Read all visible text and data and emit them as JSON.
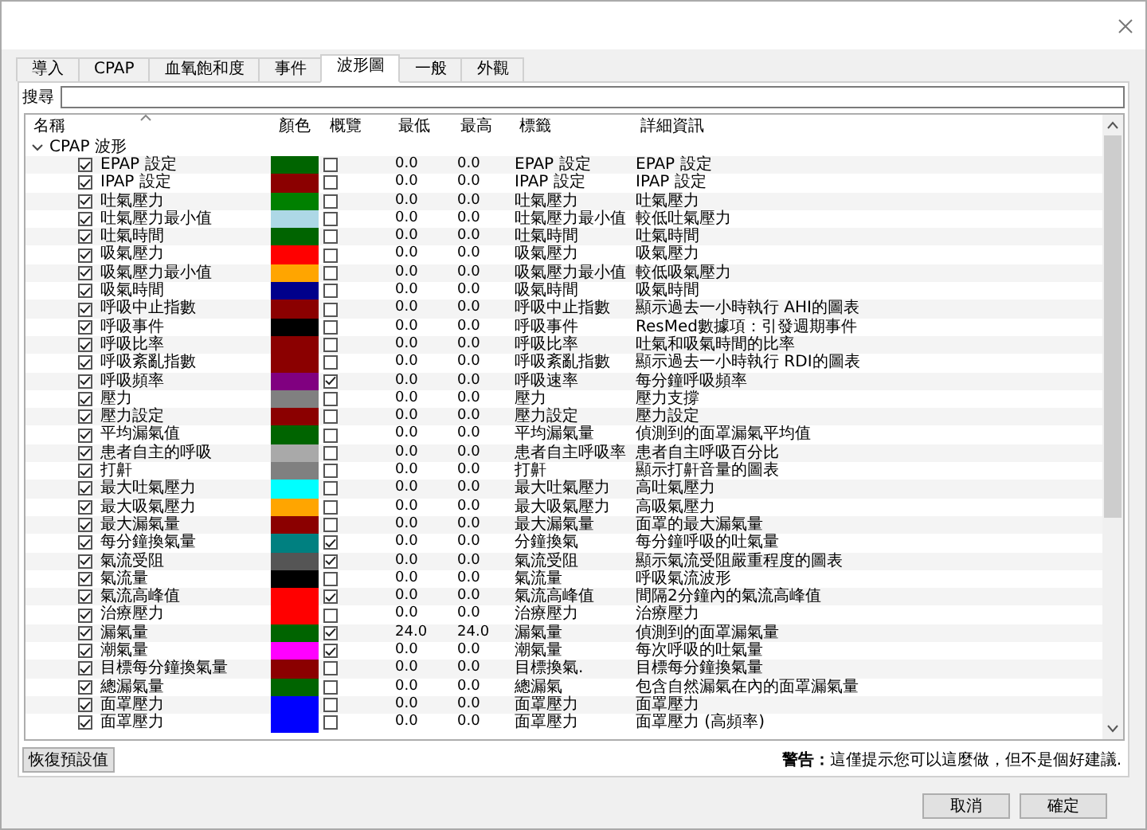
{
  "tabs": [
    {
      "label": "導入",
      "selected": false
    },
    {
      "label": "CPAP",
      "selected": false
    },
    {
      "label": "血氧飽和度",
      "selected": false
    },
    {
      "label": "事件",
      "selected": false
    },
    {
      "label": "波形圖",
      "selected": true
    },
    {
      "label": "一般",
      "selected": false
    },
    {
      "label": "外觀",
      "selected": false
    }
  ],
  "search": {
    "label": "搜尋"
  },
  "table": {
    "columns": [
      "名稱",
      "顏色",
      "概覽",
      "最低",
      "最高",
      "標籤",
      "詳細資訊"
    ],
    "group": {
      "label": "CPAP 波形",
      "expanded": true
    },
    "rows": [
      {
        "name": "EPAP 設定",
        "checked": true,
        "color": "#006400",
        "overview": false,
        "min": "0.0",
        "max": "0.0",
        "label": "EPAP 設定",
        "detail": "EPAP 設定"
      },
      {
        "name": "IPAP 設定",
        "checked": true,
        "color": "#8b0000",
        "overview": false,
        "min": "0.0",
        "max": "0.0",
        "label": "IPAP 設定",
        "detail": "IPAP 設定"
      },
      {
        "name": "吐氣壓力",
        "checked": true,
        "color": "#008000",
        "overview": false,
        "min": "0.0",
        "max": "0.0",
        "label": "吐氣壓力",
        "detail": "吐氣壓力"
      },
      {
        "name": "吐氣壓力最小值",
        "checked": true,
        "color": "#add8e6",
        "overview": false,
        "min": "0.0",
        "max": "0.0",
        "label": "吐氣壓力最小值",
        "detail": "較低吐氣壓力"
      },
      {
        "name": "吐氣時間",
        "checked": true,
        "color": "#006400",
        "overview": false,
        "min": "0.0",
        "max": "0.0",
        "label": "吐氣時間",
        "detail": "吐氣時間"
      },
      {
        "name": "吸氣壓力",
        "checked": true,
        "color": "#ff0000",
        "overview": false,
        "min": "0.0",
        "max": "0.0",
        "label": "吸氣壓力",
        "detail": "吸氣壓力"
      },
      {
        "name": "吸氣壓力最小值",
        "checked": true,
        "color": "#ffa500",
        "overview": false,
        "min": "0.0",
        "max": "0.0",
        "label": "吸氣壓力最小值",
        "detail": "較低吸氣壓力"
      },
      {
        "name": "吸氣時間",
        "checked": true,
        "color": "#00008b",
        "overview": false,
        "min": "0.0",
        "max": "0.0",
        "label": "吸氣時間",
        "detail": "吸氣時間"
      },
      {
        "name": "呼吸中止指數",
        "checked": true,
        "color": "#8b0000",
        "overview": false,
        "min": "0.0",
        "max": "0.0",
        "label": "呼吸中止指數",
        "detail": "顯示過去一小時執行 AHI的圖表"
      },
      {
        "name": "呼吸事件",
        "checked": true,
        "color": "#000000",
        "overview": false,
        "min": "0.0",
        "max": "0.0",
        "label": "呼吸事件",
        "detail": "ResMed數據項：引發週期事件"
      },
      {
        "name": "呼吸比率",
        "checked": true,
        "color": "#8b0000",
        "overview": false,
        "min": "0.0",
        "max": "0.0",
        "label": "呼吸比率",
        "detail": "吐氣和吸氣時間的比率"
      },
      {
        "name": "呼吸紊亂指數",
        "checked": true,
        "color": "#8b0000",
        "overview": false,
        "min": "0.0",
        "max": "0.0",
        "label": "呼吸紊亂指數",
        "detail": "顯示過去一小時執行 RDI的圖表"
      },
      {
        "name": "呼吸頻率",
        "checked": true,
        "color": "#800080",
        "overview": true,
        "min": "0.0",
        "max": "0.0",
        "label": "呼吸速率",
        "detail": "每分鐘呼吸頻率"
      },
      {
        "name": "壓力",
        "checked": true,
        "color": "#808080",
        "overview": false,
        "min": "0.0",
        "max": "0.0",
        "label": "壓力",
        "detail": "壓力支撐"
      },
      {
        "name": "壓力設定",
        "checked": true,
        "color": "#8b0000",
        "overview": false,
        "min": "0.0",
        "max": "0.0",
        "label": "壓力設定",
        "detail": "壓力設定"
      },
      {
        "name": "平均漏氣值",
        "checked": true,
        "color": "#006400",
        "overview": false,
        "min": "0.0",
        "max": "0.0",
        "label": "平均漏氣量",
        "detail": "偵測到的面罩漏氣平均值"
      },
      {
        "name": "患者自主的呼吸",
        "checked": true,
        "color": "#a9a9a9",
        "overview": false,
        "min": "0.0",
        "max": "0.0",
        "label": "患者自主呼吸率",
        "detail": "患者自主呼吸百分比"
      },
      {
        "name": "打鼾",
        "checked": true,
        "color": "#808080",
        "overview": false,
        "min": "0.0",
        "max": "0.0",
        "label": "打鼾",
        "detail": "顯示打鼾音量的圖表"
      },
      {
        "name": "最大吐氣壓力",
        "checked": true,
        "color": "#00ffff",
        "overview": false,
        "min": "0.0",
        "max": "0.0",
        "label": "最大吐氣壓力",
        "detail": "高吐氣壓力"
      },
      {
        "name": "最大吸氣壓力",
        "checked": true,
        "color": "#ffa500",
        "overview": false,
        "min": "0.0",
        "max": "0.0",
        "label": "最大吸氣壓力",
        "detail": "高吸氣壓力"
      },
      {
        "name": "最大漏氣量",
        "checked": true,
        "color": "#8b0000",
        "overview": false,
        "min": "0.0",
        "max": "0.0",
        "label": "最大漏氣量",
        "detail": "面罩的最大漏氣量"
      },
      {
        "name": "每分鐘換氣量",
        "checked": true,
        "color": "#008080",
        "overview": true,
        "min": "0.0",
        "max": "0.0",
        "label": "分鐘換氣",
        "detail": "每分鐘呼吸的吐氣量"
      },
      {
        "name": "氣流受阻",
        "checked": true,
        "color": "#555555",
        "overview": true,
        "min": "0.0",
        "max": "0.0",
        "label": "氣流受阻",
        "detail": "顯示氣流受阻嚴重程度的圖表"
      },
      {
        "name": "氣流量",
        "checked": true,
        "color": "#000000",
        "overview": false,
        "min": "0.0",
        "max": "0.0",
        "label": "氣流量",
        "detail": "呼吸氣流波形"
      },
      {
        "name": "氣流高峰值",
        "checked": true,
        "color": "#ff0000",
        "overview": true,
        "min": "0.0",
        "max": "0.0",
        "label": "氣流高峰值",
        "detail": "間隔2分鐘內的氣流高峰值"
      },
      {
        "name": "治療壓力",
        "checked": true,
        "color": "#ff0000",
        "overview": false,
        "min": "0.0",
        "max": "0.0",
        "label": "治療壓力",
        "detail": "治療壓力"
      },
      {
        "name": "漏氣量",
        "checked": true,
        "color": "#006400",
        "overview": true,
        "min": "24.0",
        "max": "24.0",
        "label": "漏氣量",
        "detail": "偵測到的面罩漏氣量"
      },
      {
        "name": "潮氣量",
        "checked": true,
        "color": "#ff00ff",
        "overview": true,
        "min": "0.0",
        "max": "0.0",
        "label": "潮氣量",
        "detail": "每次呼吸的吐氣量"
      },
      {
        "name": "目標每分鐘換氣量",
        "checked": true,
        "color": "#8b0000",
        "overview": false,
        "min": "0.0",
        "max": "0.0",
        "label": "目標換氣.",
        "detail": "目標每分鐘換氣量"
      },
      {
        "name": "總漏氣量",
        "checked": true,
        "color": "#006400",
        "overview": false,
        "min": "0.0",
        "max": "0.0",
        "label": "總漏氣",
        "detail": "包含自然漏氣在內的面罩漏氣量"
      },
      {
        "name": "面罩壓力",
        "checked": true,
        "color": "#0000ff",
        "overview": false,
        "min": "0.0",
        "max": "0.0",
        "label": "面罩壓力",
        "detail": "面罩壓力"
      },
      {
        "name": "面罩壓力",
        "checked": true,
        "color": "#0000ff",
        "overview": false,
        "min": "0.0",
        "max": "0.0",
        "label": "面罩壓力",
        "detail": "面罩壓力 (高頻率)"
      }
    ]
  },
  "restore_button": "恢復預設值",
  "warning": "**警告：**這僅提示您可以這麼做，但不是個好建議.",
  "buttons": [
    "取消",
    "確定"
  ]
}
